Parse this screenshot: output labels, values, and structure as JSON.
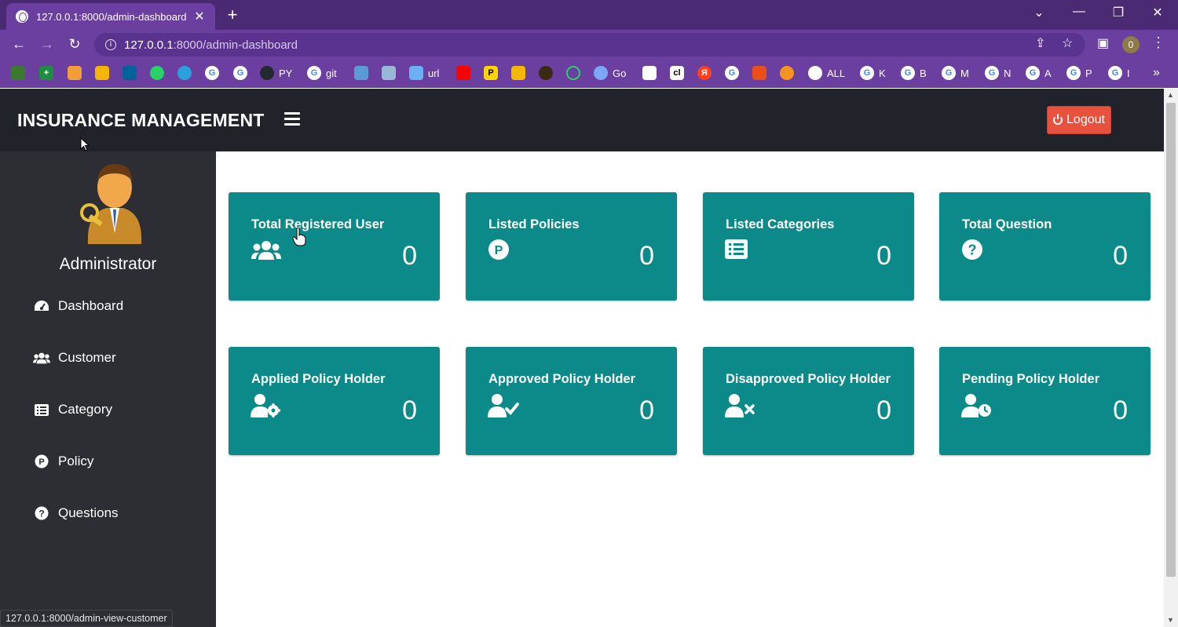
{
  "browser": {
    "tab_title": "127.0.0.1:8000/admin-dashboard",
    "url_host": "127.0.0.1",
    "url_path": ":8000/admin-dashboard",
    "profile_initial": "0",
    "bookmarks": [
      "PY",
      "git",
      "url",
      "Go",
      "ALL",
      "K",
      "B",
      "M",
      "N",
      "A",
      "P",
      "I"
    ]
  },
  "app": {
    "brand": "INSURANCE MANAGEMENT",
    "logout_label": "Logout",
    "admin_name": "Administrator"
  },
  "sidebar": {
    "items": [
      {
        "label": "Dashboard",
        "icon": "tachometer-icon"
      },
      {
        "label": "Customer",
        "icon": "users-icon"
      },
      {
        "label": "Category",
        "icon": "list-icon"
      },
      {
        "label": "Policy",
        "icon": "p-circle-icon"
      },
      {
        "label": "Questions",
        "icon": "question-circle-icon"
      }
    ]
  },
  "cards": [
    {
      "title": "Total Registered User",
      "value": "0",
      "icon": "users-icon"
    },
    {
      "title": "Listed Policies",
      "value": "0",
      "icon": "p-circle-icon"
    },
    {
      "title": "Listed Categories",
      "value": "0",
      "icon": "list-icon"
    },
    {
      "title": "Total Question",
      "value": "0",
      "icon": "question-circle-icon"
    },
    {
      "title": "Applied Policy Holder",
      "value": "0",
      "icon": "user-cog-icon"
    },
    {
      "title": "Approved Policy Holder",
      "value": "0",
      "icon": "user-check-icon"
    },
    {
      "title": "Disapproved Policy Holder",
      "value": "0",
      "icon": "user-times-icon"
    },
    {
      "title": "Pending Policy Holder",
      "value": "0",
      "icon": "user-clock-icon"
    }
  ],
  "status_url": "127.0.0.1:8000/admin-view-customer",
  "colors": {
    "card": "#0c8a8a",
    "sidebar": "#2c2e33",
    "header": "#21232a",
    "logout": "#e8513d",
    "browser": "#6b3fa0"
  }
}
